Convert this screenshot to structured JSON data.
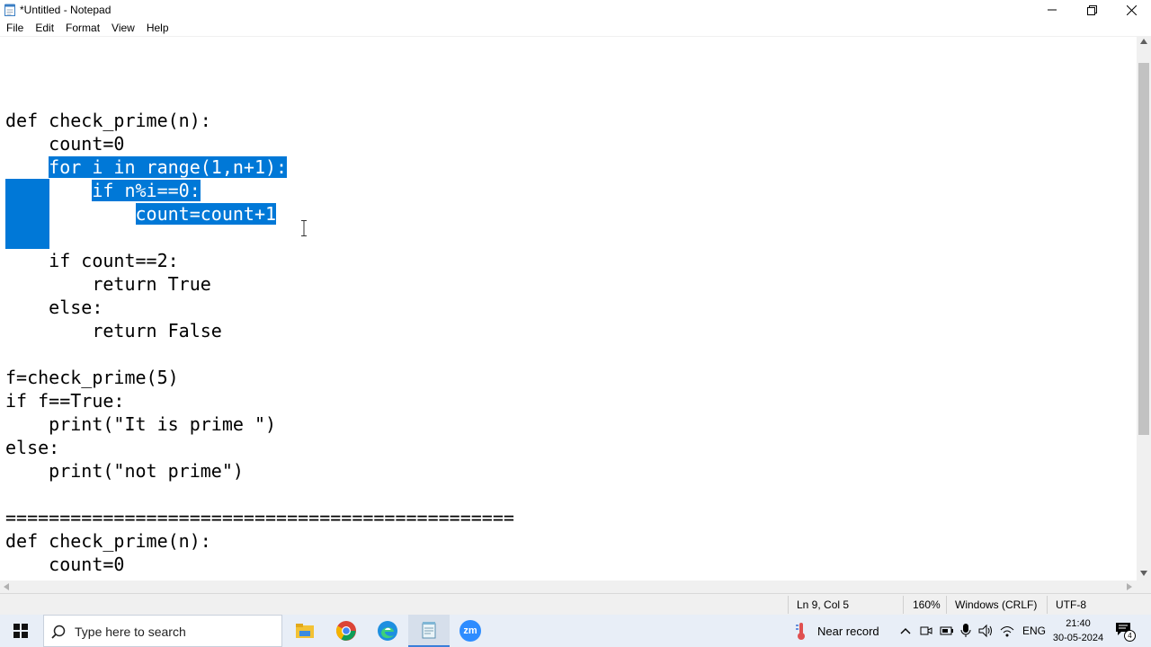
{
  "window": {
    "title": "*Untitled - Notepad",
    "controls": {
      "minimize": "minimize",
      "maximize": "restore",
      "close": "close"
    }
  },
  "menu": [
    "File",
    "Edit",
    "Format",
    "View",
    "Help"
  ],
  "editor": {
    "selection_color": "#0078d7",
    "code_lines": [
      {
        "pre": "def check_prime(n):",
        "sel": "",
        "post": ""
      },
      {
        "pre": "    count=0",
        "sel": "",
        "post": ""
      },
      {
        "pre": "    ",
        "sel": "for i in range(1,n+1):",
        "post": ""
      },
      {
        "pre": "        ",
        "sel": "if n%i==0:",
        "post": ""
      },
      {
        "pre": "            ",
        "sel": "count=count+1",
        "post": ""
      },
      {
        "pre": "",
        "sel": "",
        "post": ""
      },
      {
        "pre": "    if count==2:",
        "sel": "",
        "post": ""
      },
      {
        "pre": "        return True",
        "sel": "",
        "post": ""
      },
      {
        "pre": "    else:",
        "sel": "",
        "post": ""
      },
      {
        "pre": "        return False",
        "sel": "",
        "post": ""
      },
      {
        "pre": "",
        "sel": "",
        "post": ""
      },
      {
        "pre": "f=check_prime(5)",
        "sel": "",
        "post": ""
      },
      {
        "pre": "if f==True:",
        "sel": "",
        "post": ""
      },
      {
        "pre": "    print(\"It is prime \")",
        "sel": "",
        "post": ""
      },
      {
        "pre": "else:",
        "sel": "",
        "post": ""
      },
      {
        "pre": "    print(\"not prime\")",
        "sel": "",
        "post": ""
      },
      {
        "pre": "",
        "sel": "",
        "post": ""
      },
      {
        "pre": "===============================================",
        "sel": "",
        "post": ""
      },
      {
        "pre": "def check_prime(n):",
        "sel": "",
        "post": ""
      },
      {
        "pre": "    count=0",
        "sel": "",
        "post": ""
      }
    ]
  },
  "statusbar": {
    "position": "Ln 9, Col 5",
    "zoom": "160%",
    "line_ending": "Windows (CRLF)",
    "encoding": "UTF-8"
  },
  "taskbar": {
    "search_placeholder": "Type here to search",
    "apps": [
      "file-explorer-icon",
      "chrome-icon",
      "edge-icon",
      "notepad-icon",
      "zoom-icon"
    ],
    "zoom_label": "zm",
    "weather_text": "Near record",
    "language": "ENG",
    "time": "21:40",
    "date": "30-05-2024",
    "notification_count": "4"
  }
}
